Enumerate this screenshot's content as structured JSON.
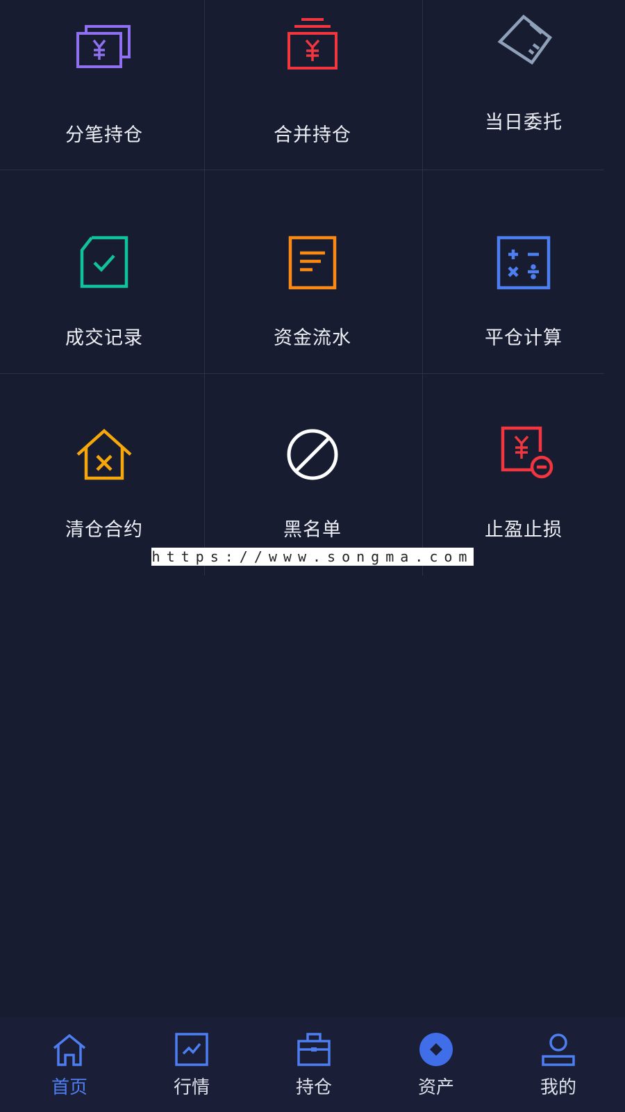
{
  "grid": {
    "items": [
      {
        "label": "分笔持仓",
        "icon": "split-position-icon",
        "color": "#8e70f0"
      },
      {
        "label": "合并持仓",
        "icon": "merged-position-icon",
        "color": "#f2363f"
      },
      {
        "label": "当日委托",
        "icon": "today-order-icon",
        "color": "#8ea1b8"
      },
      {
        "label": "成交记录",
        "icon": "trade-record-icon",
        "color": "#11c2a0"
      },
      {
        "label": "资金流水",
        "icon": "fund-flow-icon",
        "color": "#fb8a14"
      },
      {
        "label": "平仓计算",
        "icon": "calculator-icon",
        "color": "#4d7ff0"
      },
      {
        "label": "清仓合约",
        "icon": "clear-contract-icon",
        "color": "#f6a70c"
      },
      {
        "label": "黑名单",
        "icon": "blacklist-icon",
        "color": "#ffffff"
      },
      {
        "label": "止盈止损",
        "icon": "stop-profit-loss-icon",
        "color": "#f2363f"
      }
    ]
  },
  "watermark": "https://www.songma.com",
  "tabbar": {
    "active_color": "#4e7ef0",
    "items": [
      {
        "label": "首页",
        "icon": "home-icon",
        "active": true
      },
      {
        "label": "行情",
        "icon": "market-chart-icon",
        "active": false
      },
      {
        "label": "持仓",
        "icon": "briefcase-icon",
        "active": false
      },
      {
        "label": "资产",
        "icon": "assets-icon",
        "active": false
      },
      {
        "label": "我的",
        "icon": "profile-icon",
        "active": false
      }
    ]
  }
}
